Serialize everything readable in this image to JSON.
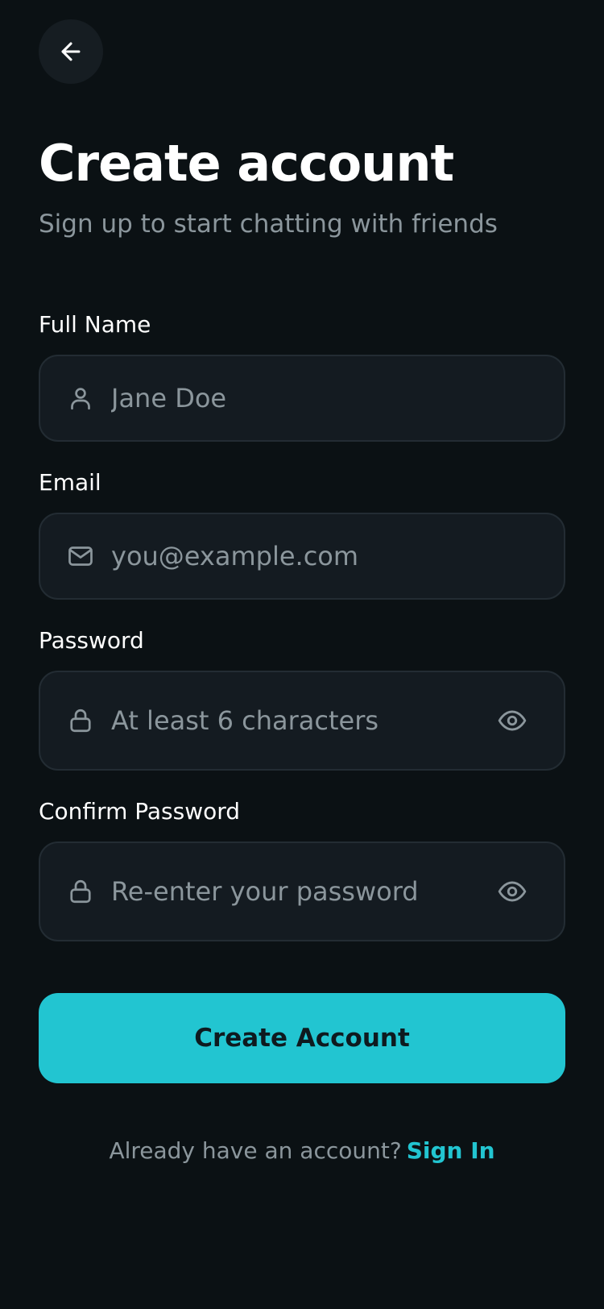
{
  "colors": {
    "background": "#0b1114",
    "input_background": "#141b21",
    "accent": "#22c5d1",
    "muted_text": "#8b969c"
  },
  "header": {
    "back_icon": "arrow-left-icon",
    "title": "Create account",
    "subtitle": "Sign up to start chatting with friends"
  },
  "form": {
    "full_name": {
      "label": "Full Name",
      "placeholder": "Jane Doe",
      "value": "",
      "icon": "user-icon"
    },
    "email": {
      "label": "Email",
      "placeholder": "you@example.com",
      "value": "",
      "icon": "mail-icon"
    },
    "password": {
      "label": "Password",
      "placeholder": "At least 6 characters",
      "value": "",
      "icon": "lock-icon",
      "toggle_icon": "eye-icon"
    },
    "confirm_password": {
      "label": "Confirm Password",
      "placeholder": "Re-enter your password",
      "value": "",
      "icon": "lock-icon",
      "toggle_icon": "eye-icon"
    },
    "submit_label": "Create Account"
  },
  "footer": {
    "prompt": "Already have an account?",
    "link_label": "Sign In"
  }
}
